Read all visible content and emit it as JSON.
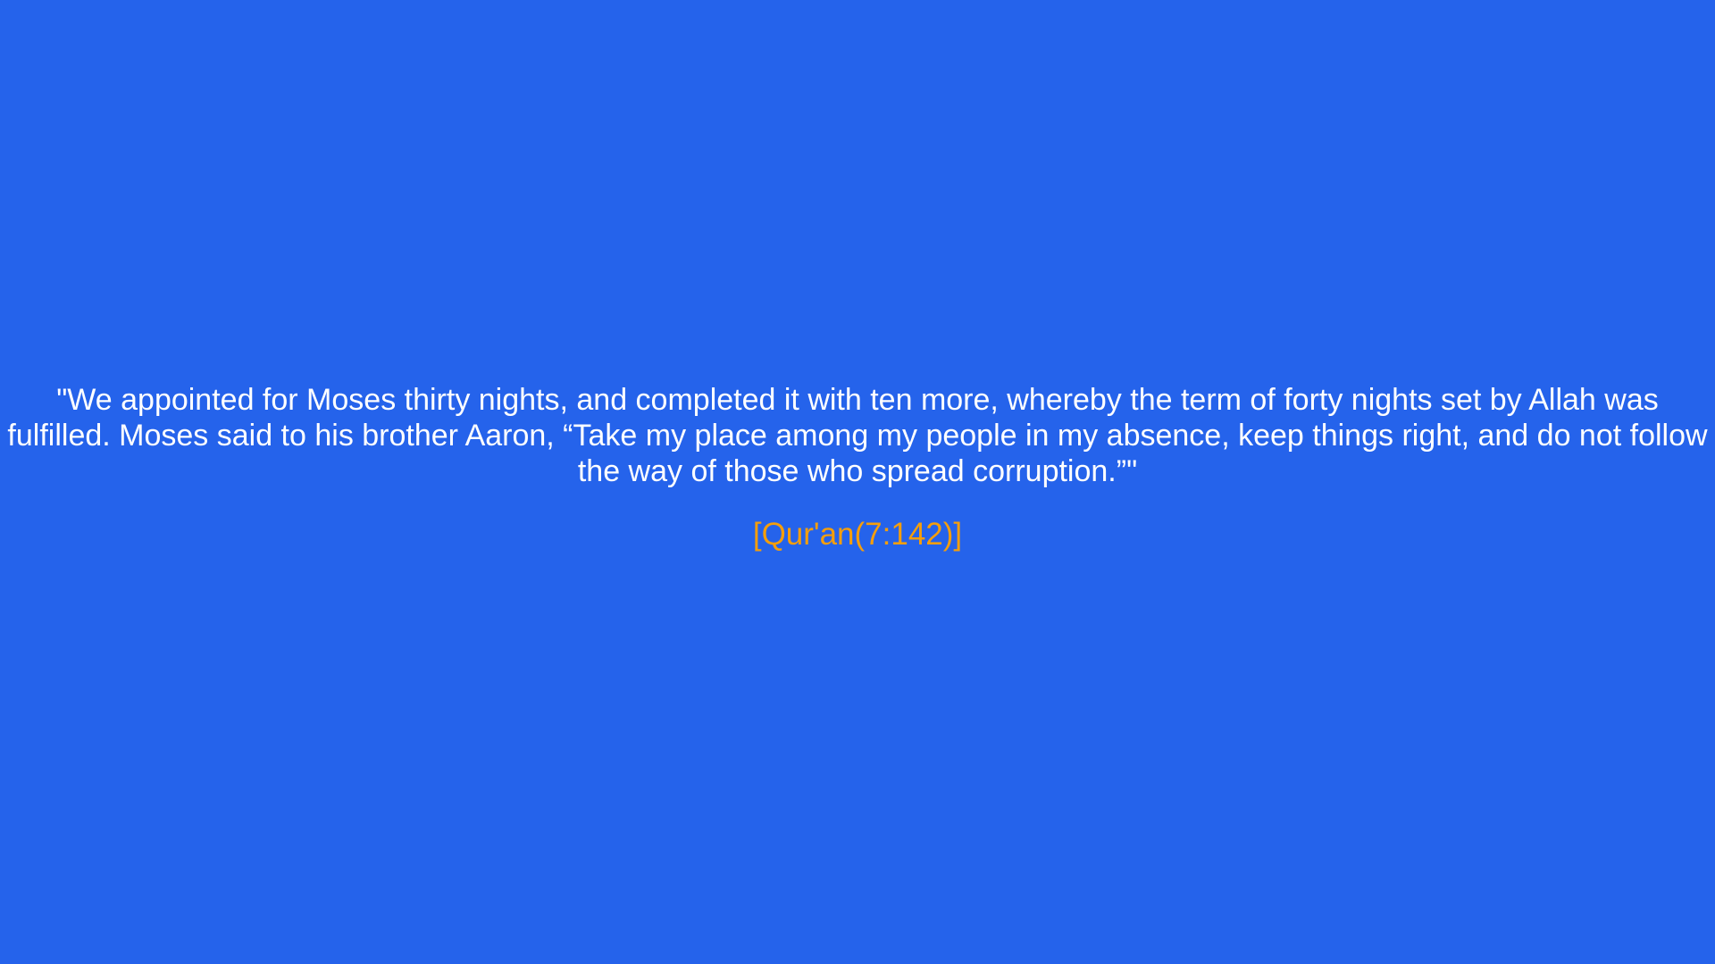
{
  "quote": {
    "text": "\"We appointed for Moses thirty nights, and completed it with ten more, whereby the term of forty nights set by Allah was fulfilled. Moses said to his brother Aaron, “Take my place among my people in my absence, keep things right, and do not follow the way of those who spread corruption.”\"",
    "source": "[Qur'an(7:142)]"
  },
  "colors": {
    "background": "#2563eb",
    "text": "#ffffff",
    "source": "#f59e0b"
  }
}
